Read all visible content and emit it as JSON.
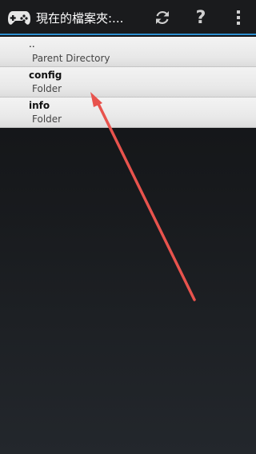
{
  "action_bar": {
    "title": "現在的檔案夾:...",
    "app_icon": "gamepad-icon",
    "refresh_icon": "refresh-icon",
    "help_label": "?",
    "overflow_icon": "overflow-menu-icon",
    "accent_color": "#2e8fd0"
  },
  "list": {
    "items": [
      {
        "name": "..",
        "subtitle": "Parent Directory"
      },
      {
        "name": "config",
        "subtitle": "Folder"
      },
      {
        "name": "info",
        "subtitle": "Folder"
      }
    ]
  },
  "annotation": {
    "arrow_color": "#e8534d"
  }
}
